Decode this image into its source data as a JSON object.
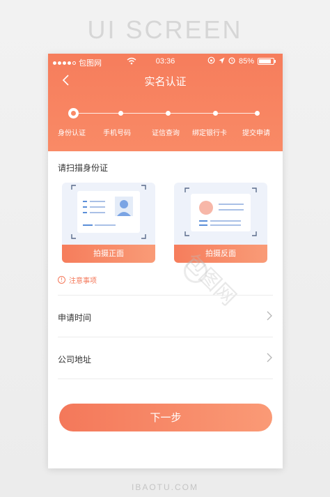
{
  "banner": "UI SCREEN",
  "status": {
    "carrier": "包图网",
    "time": "03:36",
    "battery": "85%",
    "battery_level": 0.85
  },
  "nav": {
    "title": "实名认证"
  },
  "steps": [
    {
      "label": "身份认证",
      "active": true
    },
    {
      "label": "手机号码",
      "active": false
    },
    {
      "label": "证信查询",
      "active": false
    },
    {
      "label": "绑定银行卡",
      "active": false
    },
    {
      "label": "提交申请",
      "active": false
    }
  ],
  "scan": {
    "title": "请扫描身份证",
    "front_button": "拍摄正面",
    "back_button": "拍摄反面"
  },
  "notice": {
    "text": "注意事项",
    "icon": "!"
  },
  "rows": [
    {
      "label": "申请时间"
    },
    {
      "label": "公司地址"
    }
  ],
  "next_button": "下一步",
  "watermark": "包图网",
  "footer": "IBAOTU.COM",
  "colors": {
    "accent": "#f67d5c",
    "accent_light": "#fa9a76"
  }
}
